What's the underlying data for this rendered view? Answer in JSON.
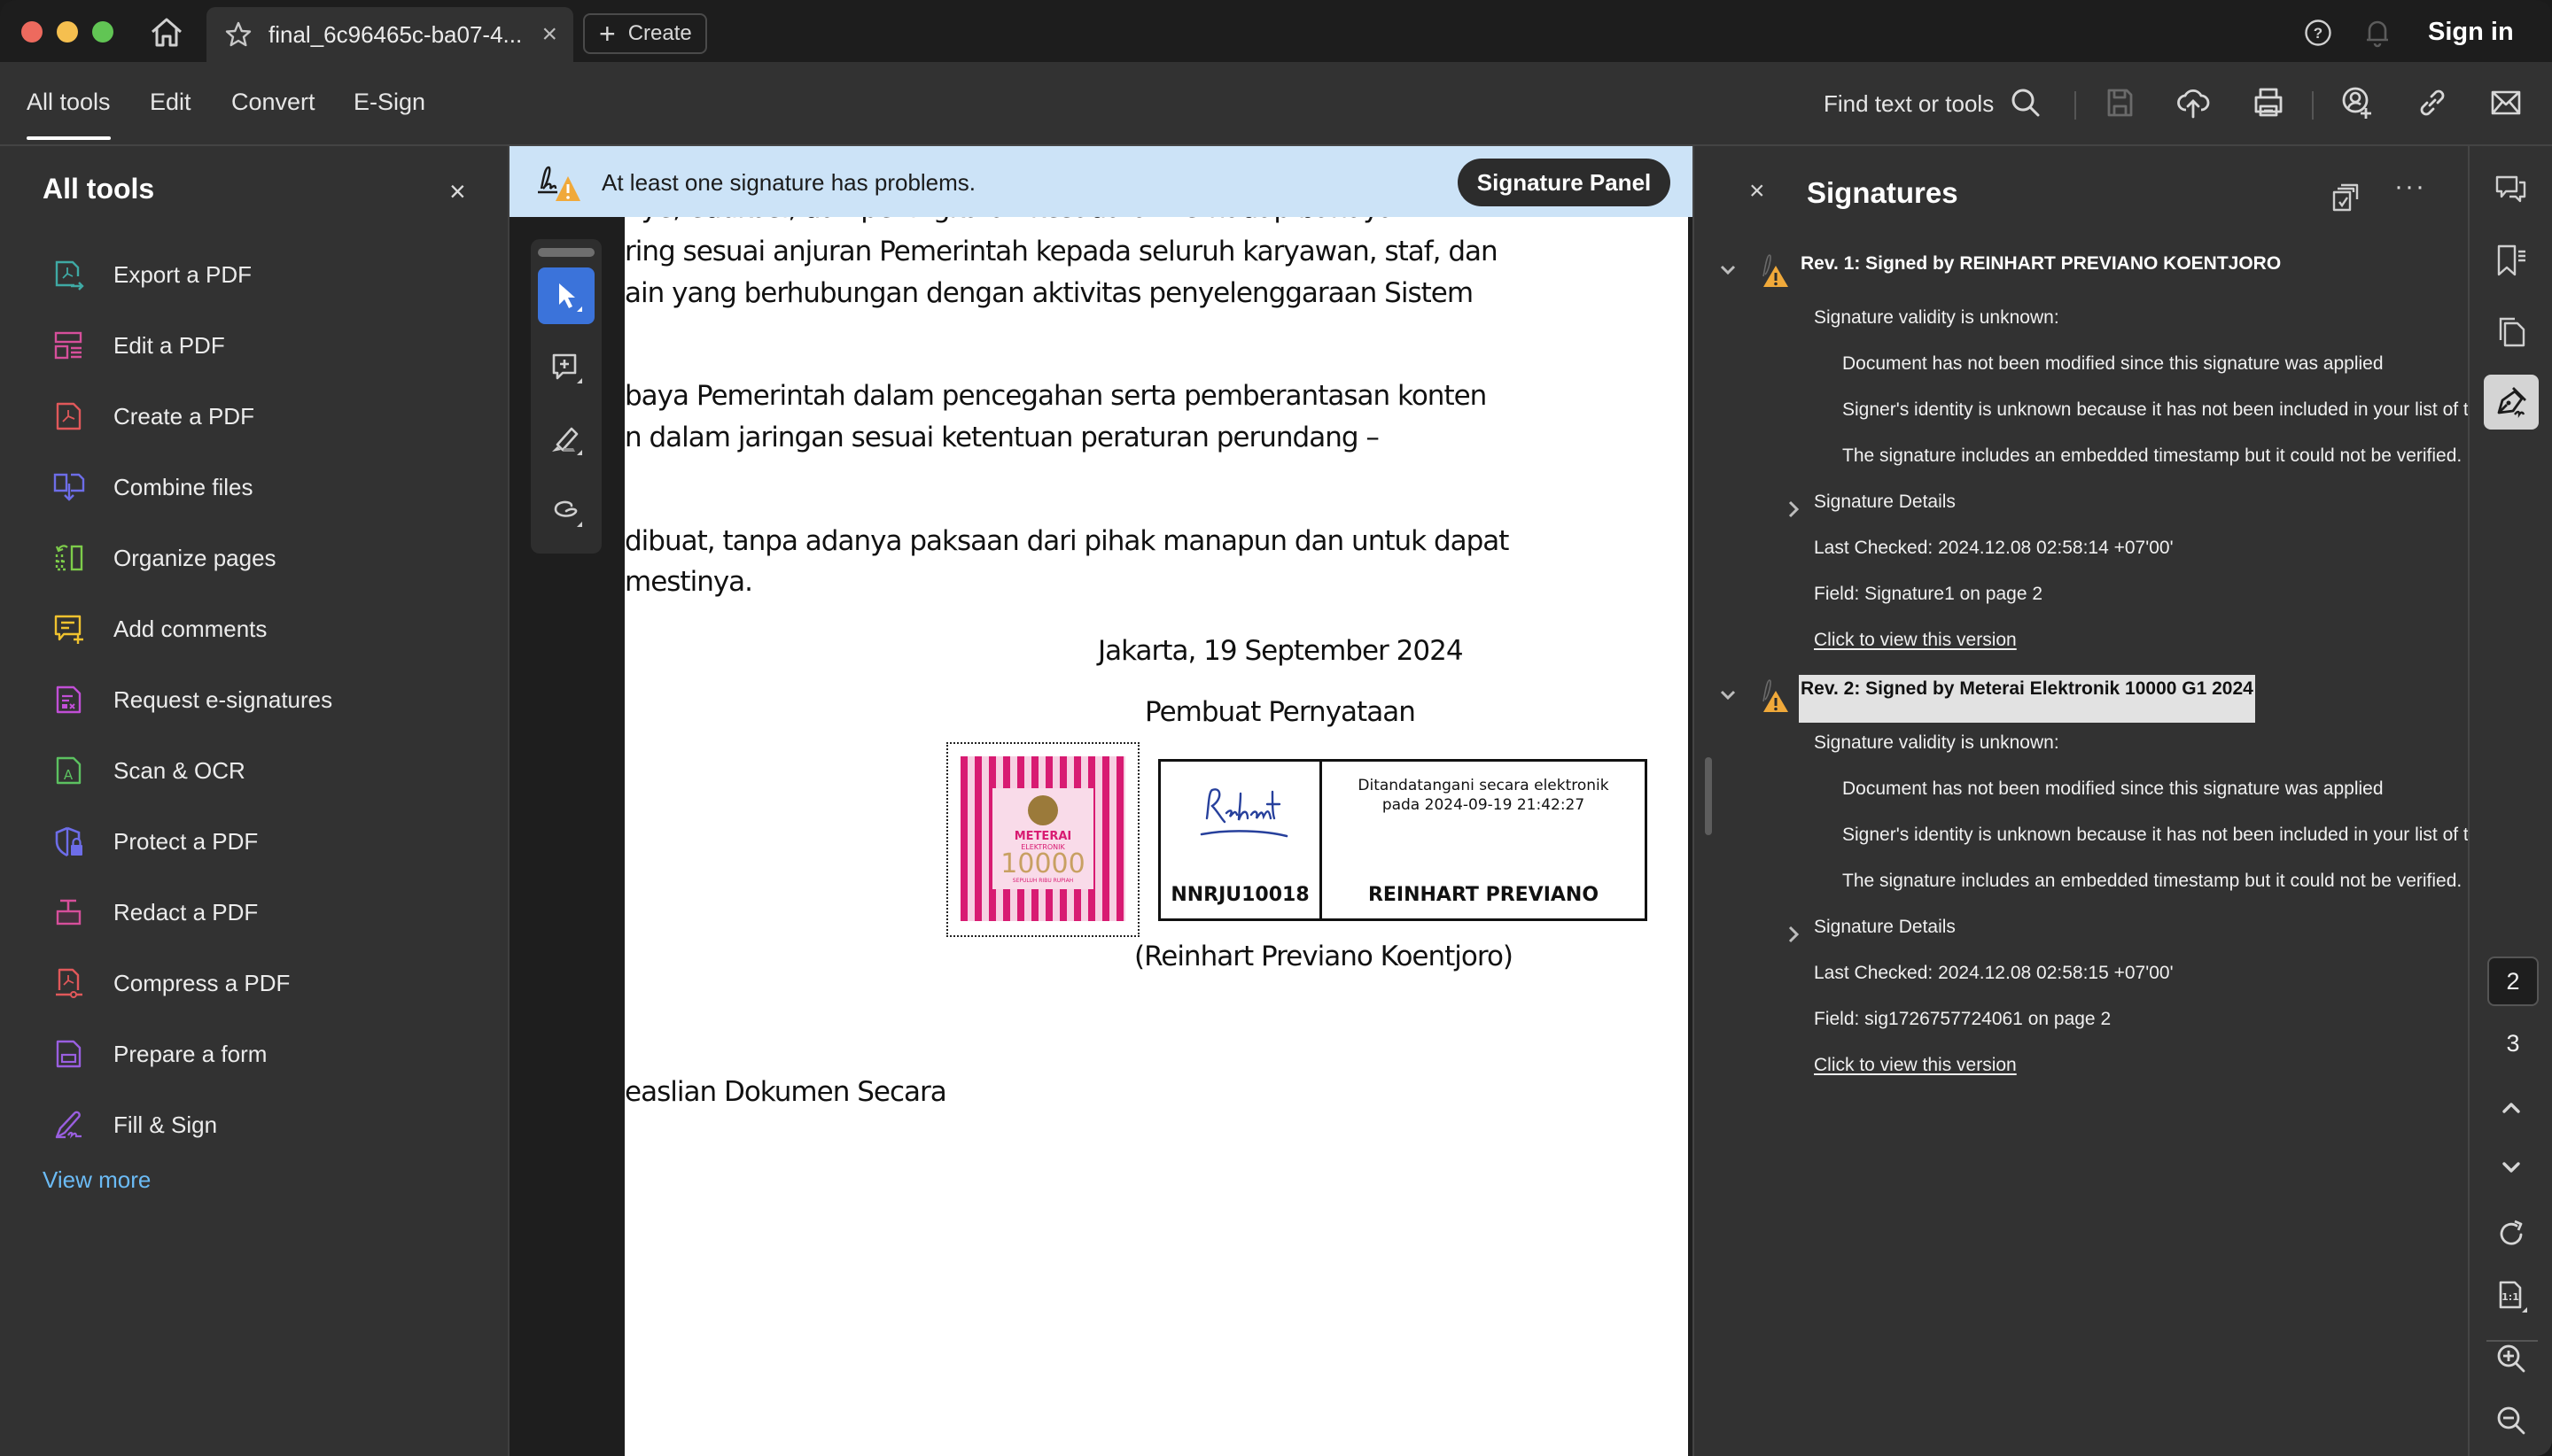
{
  "window": {
    "tab_title": "final_6c96465c-ba07-4...",
    "create_label": "Create",
    "sign_in_label": "Sign in"
  },
  "toolbar": {
    "tabs": [
      {
        "label": "All tools",
        "active": true
      },
      {
        "label": "Edit",
        "active": false
      },
      {
        "label": "Convert",
        "active": false
      },
      {
        "label": "E-Sign",
        "active": false
      }
    ],
    "find_label": "Find text or tools",
    "icons": [
      "search-icon",
      "save-icon",
      "upload-cloud-icon",
      "print-icon",
      "share-user-icon",
      "link-icon",
      "mail-icon"
    ]
  },
  "tools_panel": {
    "title": "All tools",
    "items": [
      {
        "label": "Export a PDF",
        "icon": "export-pdf-icon",
        "color": "#3fa9a4"
      },
      {
        "label": "Edit a PDF",
        "icon": "edit-pdf-icon",
        "color": "#d64f9b"
      },
      {
        "label": "Create a PDF",
        "icon": "create-pdf-icon",
        "color": "#e0585a"
      },
      {
        "label": "Combine files",
        "icon": "combine-files-icon",
        "color": "#6d6de8"
      },
      {
        "label": "Organize pages",
        "icon": "organize-pages-icon",
        "color": "#7dcc4a"
      },
      {
        "label": "Add comments",
        "icon": "add-comments-icon",
        "color": "#f0c22e"
      },
      {
        "label": "Request e-signatures",
        "icon": "request-esign-icon",
        "color": "#c14fd6"
      },
      {
        "label": "Scan & OCR",
        "icon": "scan-ocr-icon",
        "color": "#5cc160"
      },
      {
        "label": "Protect a PDF",
        "icon": "protect-pdf-icon",
        "color": "#6d6de8"
      },
      {
        "label": "Redact a PDF",
        "icon": "redact-pdf-icon",
        "color": "#d64f9b"
      },
      {
        "label": "Compress a PDF",
        "icon": "compress-pdf-icon",
        "color": "#e0585a"
      },
      {
        "label": "Prepare a form",
        "icon": "prepare-form-icon",
        "color": "#9a5fe0"
      },
      {
        "label": "Fill & Sign",
        "icon": "fill-sign-icon",
        "color": "#9a5fe0"
      }
    ],
    "view_more": "View more"
  },
  "banner": {
    "message": "At least one signature has problems.",
    "button_label": "Signature Panel"
  },
  "document": {
    "lines": [
      "nye, edukasi, dan peningkatan kesadaran terhadap bahaya",
      "ring sesuai anjuran Pemerintah kepada seluruh karyawan, staf, dan",
      "ain yang berhubungan dengan aktivitas penyelenggaraan Sistem",
      "baya Pemerintah dalam pencegahan serta pemberantasan konten",
      "n dalam jaringan sesuai ketentuan peraturan perundang –",
      "dibuat, tanpa adanya paksaan dari pihak manapun dan untuk dapat",
      "mestinya."
    ],
    "place_date": "Jakarta, 19 September 2024",
    "signer_role": "Pembuat Pernyataan",
    "meterai": {
      "label": "METERAI",
      "sub": "ELEKTRONIK",
      "value": "10000",
      "words": "SEPULUH RIBU RUPIAH"
    },
    "signature_box": {
      "scribble": "Reinhart",
      "id": "NNRJU10018",
      "meta_line1": "Ditandatangani secara elektronik",
      "meta_line2": "pada 2024-09-19 21:42:27",
      "name": "REINHART PREVIANO"
    },
    "signer_full": "(Reinhart Previano Koentjoro)",
    "footer_fragment": "easlian Dokumen Secara"
  },
  "signatures_panel": {
    "title": "Signatures",
    "revisions": [
      {
        "title": "Rev. 1: Signed by REINHART PREVIANO KOENTJORO",
        "selected": false,
        "validity": "Signature validity is unknown:",
        "reasons": [
          "Document has not been modified since this signature was applied",
          "Signer's identity is unknown because it has not been included in your list of trusted certificates",
          "The signature includes an embedded timestamp but it could not be verified."
        ],
        "details_label": "Signature Details",
        "last_checked": "Last Checked: 2024.12.08 02:58:14 +07'00'",
        "field": "Field: Signature1 on page 2",
        "view_link": "Click to view this version"
      },
      {
        "title": "Rev. 2: Signed by Meterai Elektronik 10000 G1 2024",
        "selected": true,
        "validity": "Signature validity is unknown:",
        "reasons": [
          "Document has not been modified since this signature was applied",
          "Signer's identity is unknown because it has not been included in your list of trusted certificates",
          "The signature includes an embedded timestamp but it could not be verified."
        ],
        "details_label": "Signature Details",
        "last_checked": "Last Checked: 2024.12.08 02:58:15 +07'00'",
        "field": "Field: sig1726757724061 on page 2",
        "view_link": "Click to view this version"
      }
    ]
  },
  "right_rail": {
    "pages": [
      "2",
      "3"
    ],
    "current_page": "2"
  },
  "colors": {
    "accent_blue": "#3b73da",
    "banner_bg": "#cce3f7",
    "warning": "#f0a93a",
    "link": "#6bbbf5"
  }
}
